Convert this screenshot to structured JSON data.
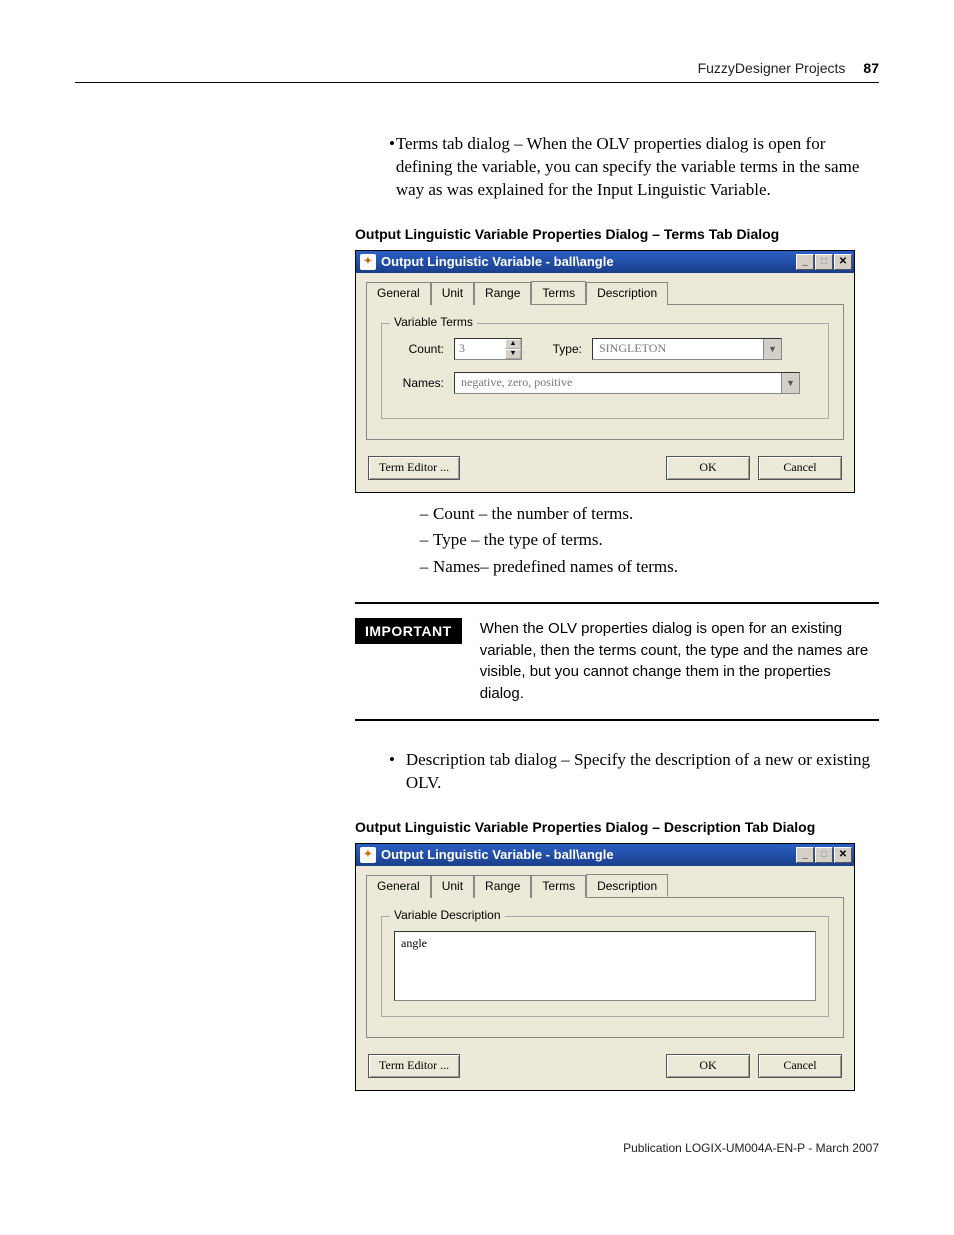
{
  "header": {
    "section": "FuzzyDesigner Projects",
    "page_number": "87"
  },
  "intro_bullet": "Terms tab dialog – When the OLV properties dialog is open for defining the variable, you can specify the variable terms in the same way as was explained for the Input Linguistic Variable.",
  "caption1": "Output Linguistic Variable Properties Dialog – Terms Tab Dialog",
  "dialog1": {
    "title": "Output Linguistic Variable - ball\\angle",
    "tabs": [
      "General",
      "Unit",
      "Range",
      "Terms",
      "Description"
    ],
    "active_tab": "Terms",
    "fieldset_label": "Variable Terms",
    "count_label": "Count:",
    "count_value": "3",
    "type_label": "Type:",
    "type_value": "SINGLETON",
    "names_label": "Names:",
    "names_value": "negative, zero, positive",
    "term_editor": "Term Editor ...",
    "ok": "OK",
    "cancel": "Cancel"
  },
  "sub_items": [
    "Count – the number of terms.",
    "Type – the type of terms.",
    "Names– predefined names of terms."
  ],
  "important": {
    "label": "IMPORTANT",
    "text": "When the OLV properties dialog is open for an existing variable, then the terms count, the type and the names are visible, but you cannot change them in the properties dialog."
  },
  "desc_bullet": "Description tab dialog – Specify the description of a new or existing OLV.",
  "caption2": "Output Linguistic Variable Properties Dialog – Description Tab Dialog",
  "dialog2": {
    "title": "Output Linguistic Variable - ball\\angle",
    "tabs": [
      "General",
      "Unit",
      "Range",
      "Terms",
      "Description"
    ],
    "active_tab": "Description",
    "fieldset_label": "Variable Description",
    "textarea_value": "angle",
    "term_editor": "Term Editor ...",
    "ok": "OK",
    "cancel": "Cancel"
  },
  "footer": "Publication LOGIX-UM004A-EN-P - March 2007"
}
